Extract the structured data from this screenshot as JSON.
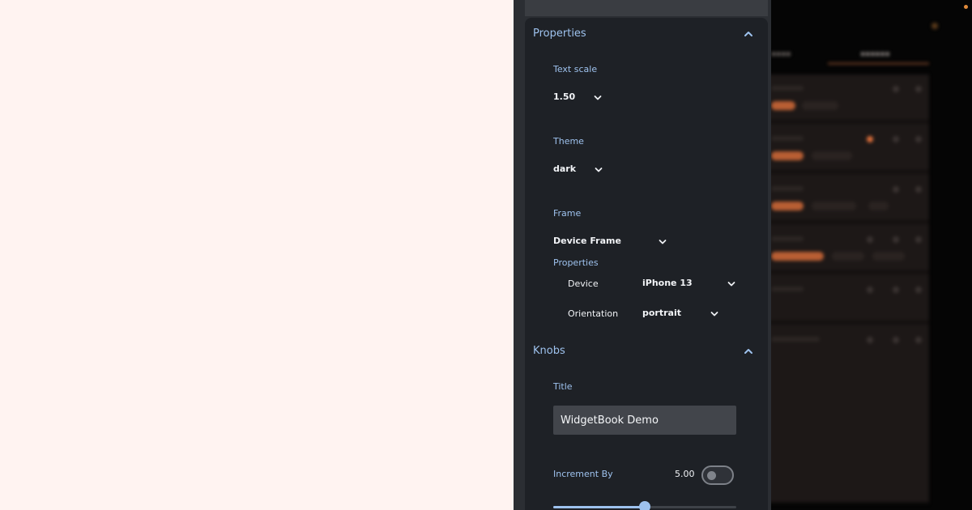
{
  "colors": {
    "accent": "#9ec2ee",
    "panel_bg": "#1e2126",
    "canvas_bg": "#fff3f1",
    "brand_orange": "#e0703b"
  },
  "properties_section": {
    "title": "Properties",
    "text_scale": {
      "label": "Text scale",
      "value": "1.50"
    },
    "theme": {
      "label": "Theme",
      "value": "dark"
    },
    "frame": {
      "label": "Frame",
      "value": "Device Frame",
      "sub_properties_label": "Properties",
      "device": {
        "label": "Device",
        "value": "iPhone 13"
      },
      "orientation": {
        "label": "Orientation",
        "value": "portrait"
      }
    }
  },
  "knobs_section": {
    "title": "Knobs",
    "title_field": {
      "label": "Title",
      "value": "WidgetBook Demo"
    },
    "increment_by": {
      "label": "Increment By",
      "value": "5.00",
      "enabled": false,
      "slider_fraction": 0.5
    }
  }
}
